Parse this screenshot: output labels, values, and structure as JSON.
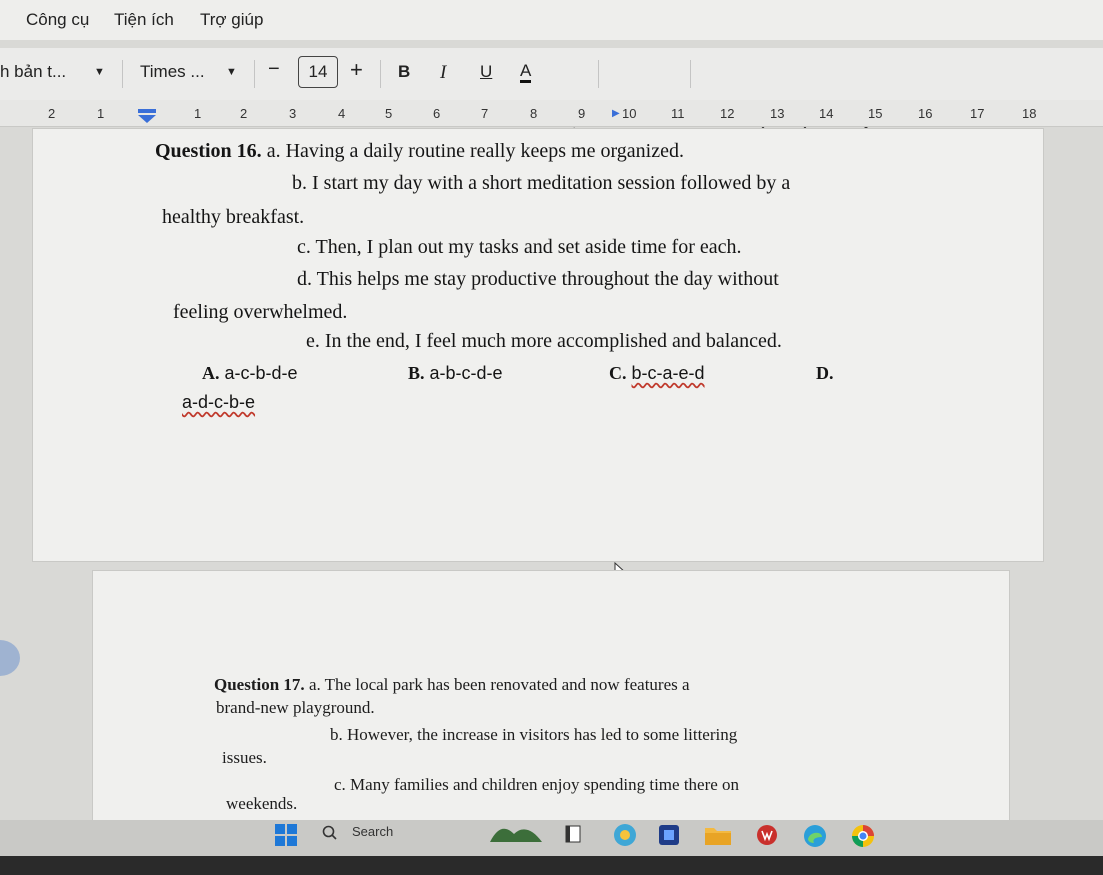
{
  "menu": {
    "items": [
      "Công cụ",
      "Tiện ích",
      "Trợ giúp"
    ]
  },
  "toolbar": {
    "style_label": "h bản t...",
    "font_label": "Times ...",
    "minus": "−",
    "font_size": "14",
    "plus": "+",
    "bold": "B",
    "italic": "I",
    "underline": "U",
    "text_color": "A"
  },
  "ruler": {
    "labels": [
      "2",
      "1",
      "1",
      "2",
      "3",
      "4",
      "5",
      "6",
      "7",
      "8",
      "9",
      "10",
      "11",
      "12",
      "13",
      "14",
      "15",
      "16",
      "17",
      "18"
    ]
  },
  "q16": {
    "prefix": "Question 16.",
    "a": "a. Having a daily routine really keeps me organized.",
    "b1": "b. I start my day with a short meditation session followed by a",
    "b2": "healthy breakfast.",
    "c": "c. Then, I plan out my tasks and set aside time for each.",
    "d1": "d. This helps me stay productive throughout the day without",
    "d2": "feeling overwhelmed.",
    "e": "e. In the end, I feel much more accomplished and balanced.",
    "options": [
      {
        "letter": "A.",
        "text": "a-c-b-d-e"
      },
      {
        "letter": "B.",
        "text": "a-b-c-d-e"
      },
      {
        "letter": "C.",
        "text": "b-c-a-e-d"
      },
      {
        "letter": "D.",
        "text": "a-d-c-b-e"
      }
    ]
  },
  "q17": {
    "prefix": "Question 17.",
    "a1": "a. The local park has been renovated and now features a",
    "a2": "brand-new playground.",
    "b1": "b. However, the increase in visitors has led to some littering",
    "b2": "issues.",
    "c1": "c. Many families and children enjoy spending time there on",
    "c2": "weekends."
  },
  "taskbar": {
    "search_label": "Search"
  }
}
